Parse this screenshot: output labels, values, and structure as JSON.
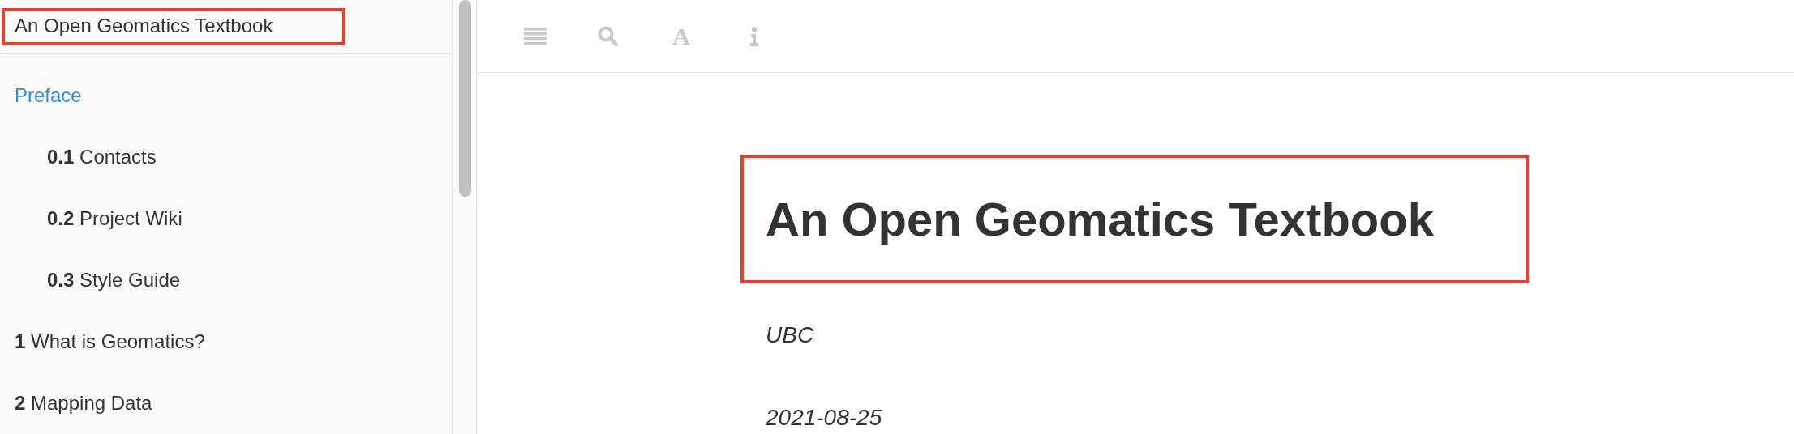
{
  "sidebar": {
    "title": "An Open Geomatics Textbook",
    "items": [
      {
        "label": "Preface",
        "selected": true,
        "children": [
          {
            "number": "0.1",
            "label": "Contacts",
            "selected": false
          },
          {
            "number": "0.2",
            "label": "Project Wiki",
            "selected": false
          },
          {
            "number": "0.3",
            "label": "Style Guide",
            "selected": false
          }
        ]
      },
      {
        "number": "1",
        "label": "What is Geomatics?",
        "selected": false
      },
      {
        "number": "2",
        "label": "Mapping Data",
        "selected": false
      }
    ]
  },
  "toolbar": [
    {
      "kind": "menu"
    },
    {
      "kind": "search"
    },
    {
      "kind": "font",
      "glyph": "A"
    },
    {
      "kind": "info"
    }
  ],
  "content": {
    "title": "An Open Geomatics Textbook",
    "author": "UBC",
    "date": "2021-08-25"
  }
}
